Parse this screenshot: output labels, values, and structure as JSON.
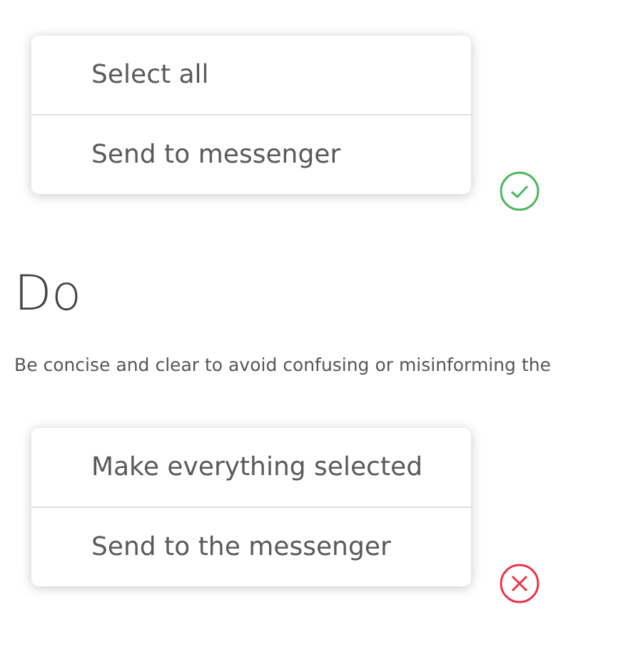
{
  "top_example": {
    "kind": "good",
    "items": [
      {
        "label": "Select all"
      },
      {
        "label": "Send to messenger"
      }
    ]
  },
  "heading": "Do",
  "description": "Be concise and clear to avoid confusing or misinforming the",
  "bottom_example": {
    "kind": "bad",
    "items": [
      {
        "label": "Make everything selected"
      },
      {
        "label": "Send to the messenger"
      }
    ]
  }
}
